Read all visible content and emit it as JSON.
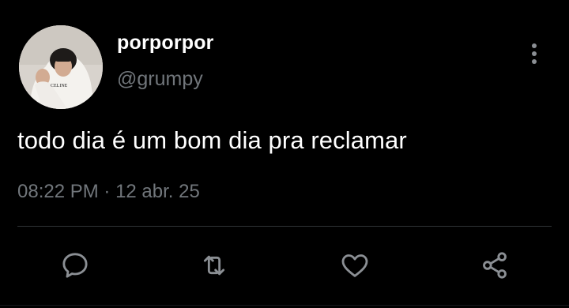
{
  "tweet": {
    "display_name": "porporpor",
    "handle": "@grumpy",
    "text": "todo dia é um bom dia pra reclamar",
    "time": "08:22 PM",
    "separator": " · ",
    "date": "12 abr. 25",
    "avatar_shirt_text": "CELINE"
  },
  "icons": {
    "more": "more-vertical-icon",
    "reply": "reply-icon",
    "retweet": "retweet-icon",
    "like": "heart-icon",
    "share": "share-icon"
  },
  "colors": {
    "background": "#000000",
    "primary_text": "#ffffff",
    "secondary_text": "#71767b",
    "divider": "#2f3336"
  }
}
